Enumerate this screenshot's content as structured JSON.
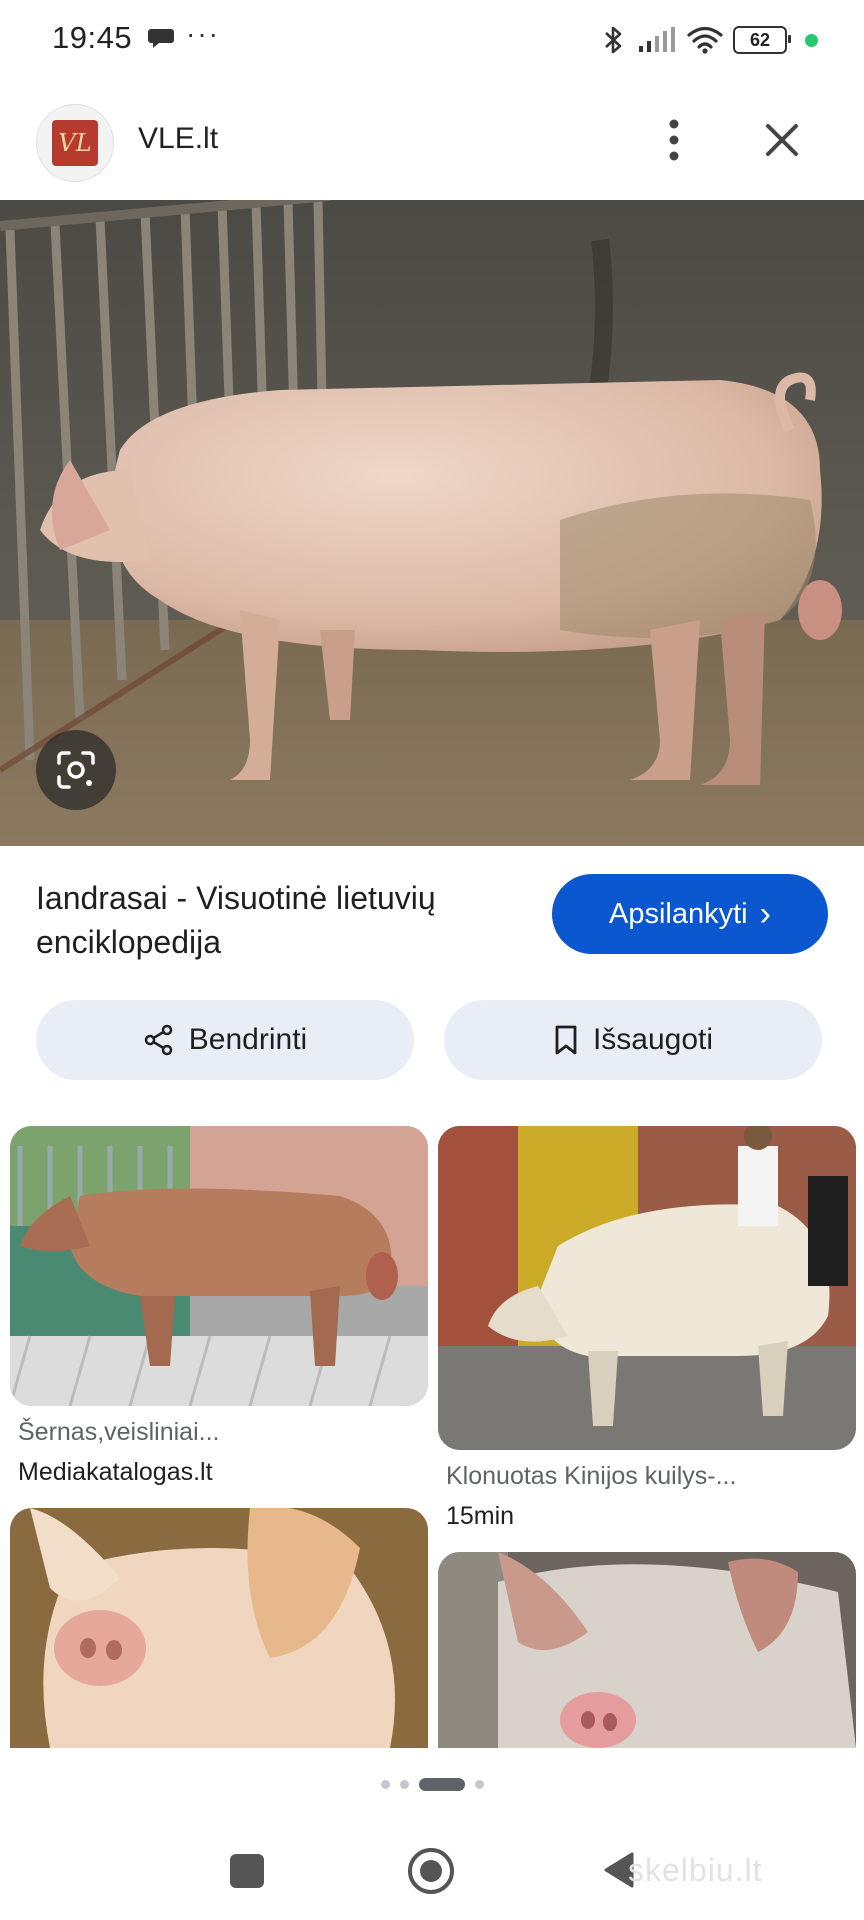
{
  "status_bar": {
    "time": "19:45",
    "dots": "···",
    "battery": "62"
  },
  "header": {
    "logo_text": "VL",
    "site_name": "VLE.lt",
    "icons": [
      "more-vert-icon",
      "close-icon"
    ]
  },
  "hero": {
    "lens_icon": "google-lens-icon"
  },
  "result": {
    "title": "Iandrasai - Visuotinė lietuvių enciklopedija",
    "visit_label": "Apsilankyti",
    "visit_chevron": "›",
    "accent_color": "#0b57d0"
  },
  "actions": {
    "share_label": "Bendrinti",
    "save_label": "Išsaugoti"
  },
  "related": [
    {
      "caption": "Šernas,veisliniai...",
      "source": "Mediakatalogas.lt"
    },
    {
      "caption": "Klonuotas Kinijos kuilys-...",
      "source": "15min"
    },
    {
      "caption": "",
      "source": ""
    },
    {
      "caption": "",
      "source": ""
    }
  ],
  "watermark": "skelbiu.lt"
}
